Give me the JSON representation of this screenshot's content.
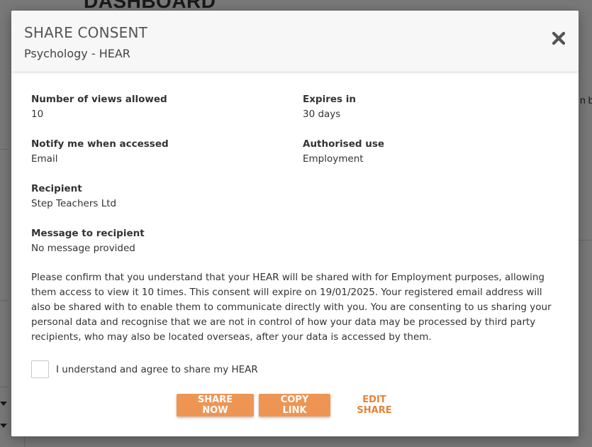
{
  "background": {
    "page_title": "DASHBOARD",
    "right_edge_text": "n b"
  },
  "modal": {
    "title": "SHARE CONSENT",
    "subtitle": "Psychology - HEAR",
    "close_icon": "close-x-icon",
    "fields": {
      "views": {
        "label": "Number of views allowed",
        "value": "10"
      },
      "expires": {
        "label": "Expires in",
        "value": "30 days"
      },
      "notify": {
        "label": "Notify me when accessed",
        "value": "Email"
      },
      "use": {
        "label": "Authorised use",
        "value": "Employment"
      },
      "recipient": {
        "label": "Recipient",
        "value": "Step Teachers Ltd"
      },
      "message": {
        "label": "Message to recipient",
        "value": "No message provided"
      }
    },
    "consent_text": "Please confirm that you understand that your HEAR will be shared with for Employment purposes, allowing them access to view it 10 times. This consent will expire on 19/01/2025. Your registered email address will also be shared with to enable them to communicate directly with you. You are consenting to us sharing your personal data and recognise that we are not in control of how your data may be processed by third party recipients, who may also be located overseas, after your data is accessed by them.",
    "agree": {
      "label": "I understand and agree to share my HEAR",
      "checked": false
    },
    "buttons": {
      "share_now": "SHARE NOW",
      "copy_link": "COPY LINK",
      "edit_share": "EDIT SHARE"
    }
  },
  "colors": {
    "accent": "#ee9554",
    "link": "#e8823a",
    "overlay": "rgba(0,0,0,0.5)"
  }
}
